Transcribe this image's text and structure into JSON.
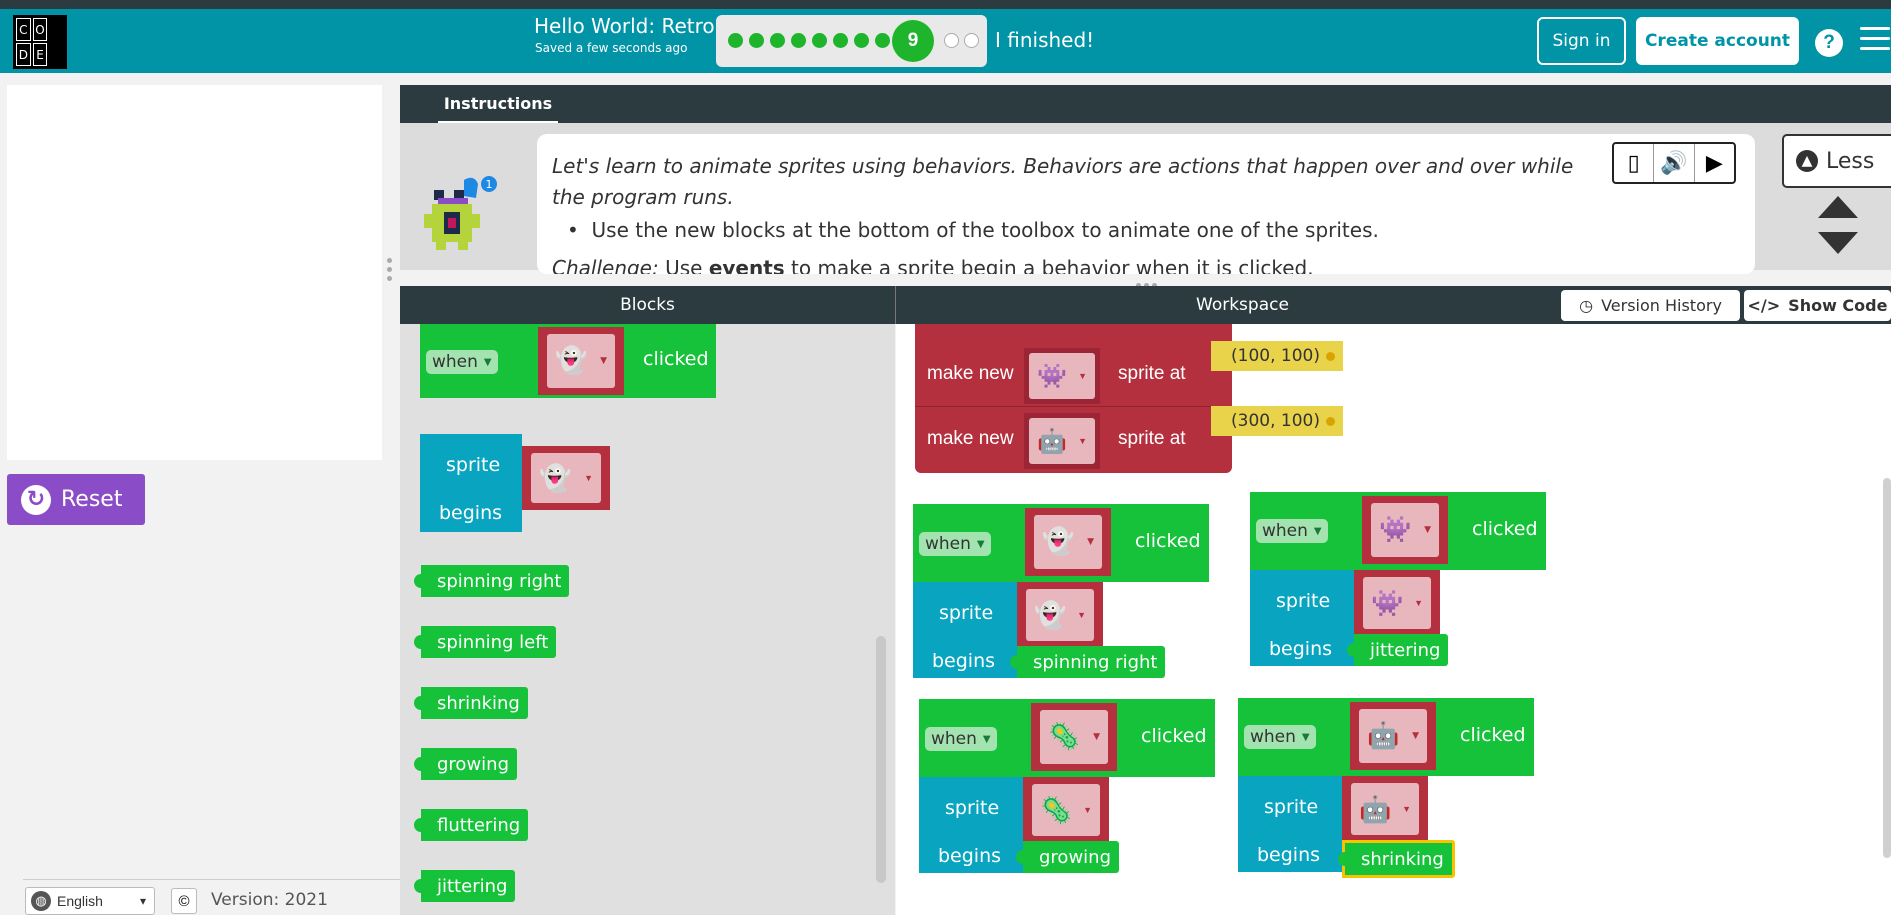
{
  "colors": {
    "header": "#0094a6",
    "dark_bar": "#2b3b40",
    "green": "#15c23a",
    "teal": "#09a5c0",
    "red": "#b5303f",
    "purple": "#8b4cc7"
  },
  "logo": {
    "letters": [
      "C",
      "O",
      "D",
      "E"
    ]
  },
  "project": {
    "title": "Hello World: Retro",
    "saved": "Saved a few seconds ago"
  },
  "progress": {
    "current_level": "9",
    "completed_dots": 8,
    "remaining_dots": 2,
    "finished_label": "I finished!"
  },
  "header": {
    "sign_in": "Sign in",
    "create_account": "Create account",
    "help": "?"
  },
  "left": {
    "reset_label": "Reset",
    "language": "English",
    "copyright_icon": "©",
    "version": "Version: 2021"
  },
  "instructions": {
    "tab": "Instructions",
    "text": "Let's learn to animate sprites using behaviors. Behaviors are actions that happen over and over while the program runs.",
    "bullet": "Use the new blocks at the bottom of the toolbox to animate one of the sprites.",
    "challenge_prefix": "Challenge:",
    "challenge_mid": " Use ",
    "challenge_bold": "events",
    "challenge_rest": " to make a sprite begin a behavior when it is clicked.",
    "less_label": "Less",
    "badge": "1"
  },
  "editor": {
    "blocks_title": "Blocks",
    "workspace_title": "Workspace",
    "version_history": "Version History",
    "show_code": "Show Code"
  },
  "toolbox": {
    "when_label": "when",
    "clicked_label": "clicked",
    "sprite_label": "sprite",
    "begins_label": "begins",
    "behaviors": [
      "spinning right",
      "spinning left",
      "shrinking",
      "growing",
      "fluttering",
      "jittering"
    ]
  },
  "workspace": {
    "make_new_label": "make new",
    "sprite_at_label": "sprite at",
    "coords": [
      "(100, 100)",
      "(300, 100)"
    ],
    "when_label": "when",
    "clicked_label": "clicked",
    "sprite_label": "sprite",
    "begins_label": "begins",
    "behaviors": [
      "spinning right",
      "jittering",
      "growing",
      "shrinking"
    ]
  }
}
